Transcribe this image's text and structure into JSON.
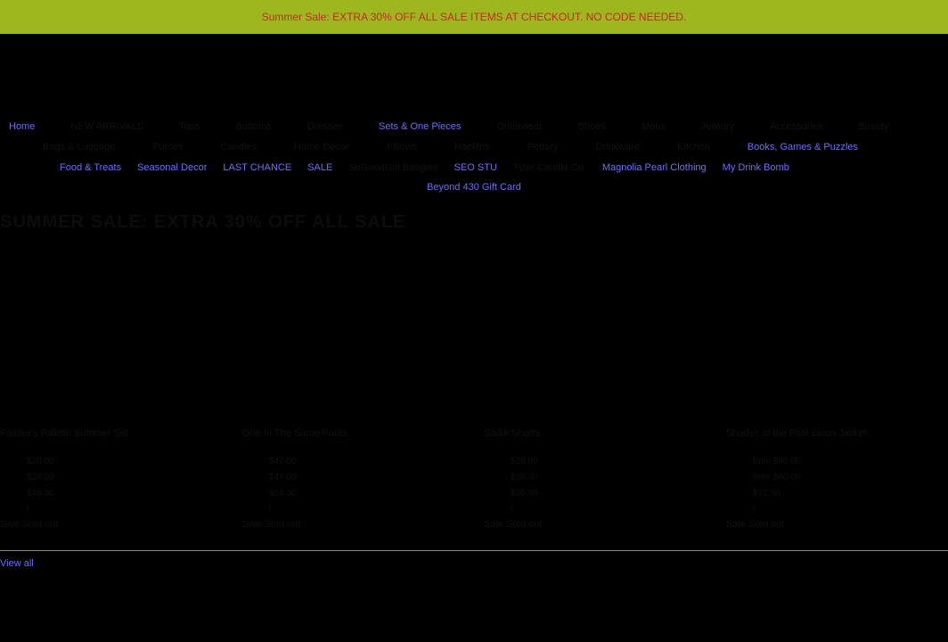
{
  "announcement": {
    "text": "Summer Sale: EXTRA 30% OFF ALL SALE ITEMS AT CHECKOUT. NO CODE NEEDED."
  },
  "nav": {
    "row1": [
      {
        "label": "Home",
        "highlight": true
      },
      {
        "label": "NEW ARRIVALS",
        "highlight": false
      },
      {
        "label": "Tops",
        "highlight": false
      },
      {
        "label": "Bottoms",
        "highlight": false
      },
      {
        "label": "Dresses",
        "highlight": false
      },
      {
        "label": "Sets & One Pieces",
        "highlight": true
      },
      {
        "label": "Outerwear",
        "highlight": false
      },
      {
        "label": "Shoes",
        "highlight": false
      },
      {
        "label": "Mens",
        "highlight": false
      },
      {
        "label": "Jewelry",
        "highlight": false
      },
      {
        "label": "Accessories",
        "highlight": false
      },
      {
        "label": "Beauty",
        "highlight": false
      }
    ],
    "row2": [
      {
        "label": "Bags & Luggage",
        "highlight": false
      },
      {
        "label": "Purses",
        "highlight": false
      },
      {
        "label": "Candles",
        "highlight": false
      },
      {
        "label": "Home Decor",
        "highlight": false
      },
      {
        "label": "Pillows",
        "highlight": false
      },
      {
        "label": "Napkins",
        "highlight": false
      },
      {
        "label": "Pottery",
        "highlight": false
      },
      {
        "label": "Drinkware",
        "highlight": false
      },
      {
        "label": "Kitchen",
        "highlight": false
      },
      {
        "label": "Books, Games & Puzzles",
        "highlight": true
      }
    ],
    "row3": [
      {
        "label": "Food & Treats",
        "highlight": true
      },
      {
        "label": "Seasonal Decor",
        "highlight": true
      },
      {
        "label": "LAST CHANCE",
        "highlight": true
      },
      {
        "label": "SALE",
        "highlight": true
      },
      {
        "label": "SoGoodGirl Bangles",
        "highlight": false
      },
      {
        "label": "SEO STU",
        "highlight": true
      },
      {
        "label": "Tyler Candle Co.",
        "highlight": false
      },
      {
        "label": "Magnolia Pearl Clothing",
        "highlight": true
      },
      {
        "label": "My Drink Bomb",
        "highlight": true
      }
    ],
    "row4": [
      {
        "label": "Beyond 430 Gift Card",
        "highlight": true
      }
    ]
  },
  "collection": {
    "title": "SUMMER SALE: EXTRA 30% OFF ALL SALE"
  },
  "products": [
    {
      "title": "Painter's Palette Summer Set",
      "prices": [
        "$28.00",
        "$28.00",
        "$40.00"
      ],
      "separator": "/",
      "badge": "Sale Sold out"
    },
    {
      "title": "One In The Same Pants",
      "prices": [
        "$47.00",
        "$47.00",
        "$68.00"
      ],
      "separator": "/",
      "badge": "Sale Sold out"
    },
    {
      "title": "Sailor Shorts",
      "prices": [
        "$28.00",
        "$28.00",
        "$60.00"
      ],
      "separator": "/",
      "badge": "Sale Sold out"
    },
    {
      "title": "Shades of the Past Linen Jacket",
      "prices": [
        "from $80.00",
        "from $80.00",
        "$72.00"
      ],
      "separator": "/",
      "badge": "Sale Sold out"
    }
  ],
  "footer": {
    "view_all": "View all"
  },
  "colors": {
    "announcement_bg": "#9fb71f",
    "announcement_text": "#c62828",
    "link_highlight": "#6d6dff",
    "page_bg": "#000000"
  }
}
